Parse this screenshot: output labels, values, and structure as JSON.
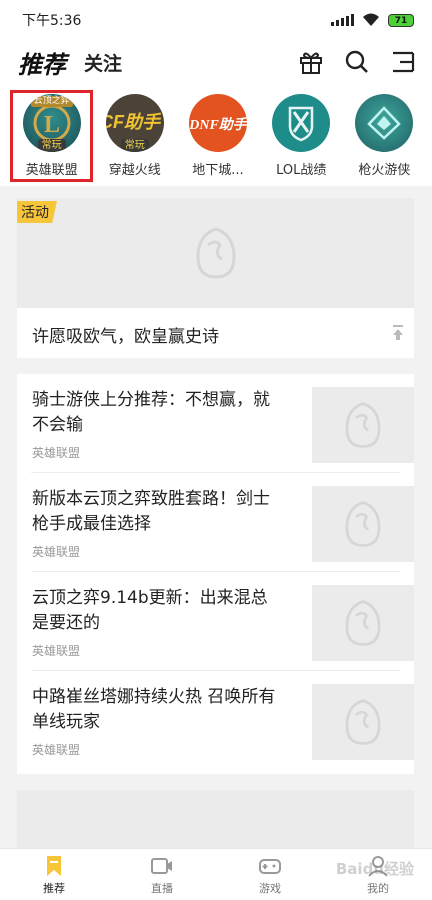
{
  "status_bar": {
    "time": "下午5:36",
    "battery": "71"
  },
  "header": {
    "tabs": [
      {
        "label": "推荐"
      },
      {
        "label": "关注"
      }
    ],
    "icons": [
      "gift-icon",
      "search-icon",
      "menu-icon"
    ]
  },
  "games": [
    {
      "label": "英雄联盟",
      "badge": "常玩",
      "top_badge": "云顶之弈",
      "mark": "L",
      "selected": true
    },
    {
      "label": "穿越火线",
      "badge": "常玩",
      "mark": "CF助手"
    },
    {
      "label": "地下城...",
      "mark": "DNF助手"
    },
    {
      "label": "LOL战绩",
      "mark": ""
    },
    {
      "label": "枪火游侠",
      "mark": ""
    }
  ],
  "activity": {
    "tag": "活动",
    "title": "许愿吸欧气，欧皇赢史诗"
  },
  "news": [
    {
      "title": "骑士游侠上分推荐：不想赢，就不会输",
      "source": "英雄联盟"
    },
    {
      "title": "新版本云顶之弈致胜套路！剑士枪手成最佳选择",
      "source": "英雄联盟"
    },
    {
      "title": "云顶之弈9.14b更新：出来混总是要还的",
      "source": "英雄联盟"
    },
    {
      "title": "中路崔丝塔娜持续火热 召唤所有单线玩家",
      "source": "英雄联盟"
    }
  ],
  "bottom_nav": [
    {
      "label": "推荐",
      "icon": "bookmark-icon",
      "active": true
    },
    {
      "label": "直播",
      "icon": "video-icon"
    },
    {
      "label": "游戏",
      "icon": "gamepad-icon"
    },
    {
      "label": "我的",
      "icon": "user-icon"
    }
  ],
  "watermark": "Baidu经验",
  "colors": {
    "accent": "#f7c53a",
    "selection": "#e0242b",
    "placeholder": "#ebebeb"
  }
}
